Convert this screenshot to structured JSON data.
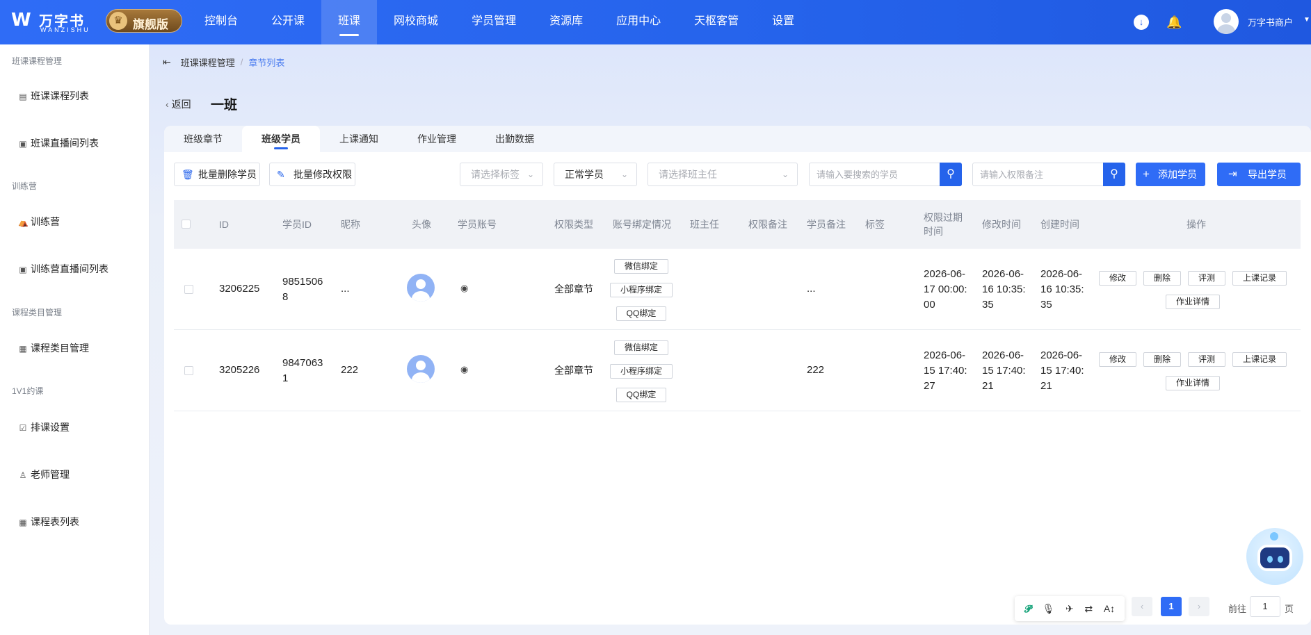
{
  "header": {
    "logo_mark": "W",
    "logo_cn": "万字书",
    "logo_en": "WANZISHU",
    "edition": "旗舰版",
    "nav": [
      "控制台",
      "公开课",
      "班课",
      "网校商城",
      "学员管理",
      "资源库",
      "应用中心",
      "天枢客管",
      "设置"
    ],
    "active_nav": "班课",
    "merchant": "万字书商户"
  },
  "sidebar": {
    "groups": [
      {
        "title": "班课课程管理",
        "items": [
          "班课课程列表",
          "班课直播间列表"
        ]
      },
      {
        "title": "训练营",
        "items": [
          "训练营",
          "训练营直播间列表"
        ]
      },
      {
        "title": "课程类目管理",
        "items": [
          "课程类目管理"
        ]
      },
      {
        "title": "1V1约课",
        "items": [
          "排课设置",
          "老师管理",
          "课程表列表"
        ]
      }
    ]
  },
  "breadcrumb": {
    "parent": "班课课程管理",
    "separator": "/",
    "current": "章节列表"
  },
  "page": {
    "back": "返回",
    "title": "一班"
  },
  "tabs": [
    "班级章节",
    "班级学员",
    "上课通知",
    "作业管理",
    "出勤数据"
  ],
  "active_tab": "班级学员",
  "toolbar": {
    "batch_delete": "批量删除学员",
    "batch_modify": "批量修改权限",
    "tag_select_placeholder": "请选择标签",
    "status_select_value": "正常学员",
    "teacher_select_placeholder": "请选择班主任",
    "student_search_placeholder": "请输入要搜索的学员",
    "remark_search_placeholder": "请输入权限备注",
    "add_student": "添加学员",
    "export_student": "导出学员"
  },
  "table": {
    "columns": [
      "ID",
      "学员ID",
      "昵称",
      "头像",
      "学员账号",
      "权限类型",
      "账号绑定情况",
      "班主任",
      "权限备注",
      "学员备注",
      "标签",
      "权限过期时间",
      "修改时间",
      "创建时间",
      "操作"
    ],
    "bind_labels": [
      "微信绑定",
      "小程序绑定",
      "QQ绑定"
    ],
    "actions": [
      "修改",
      "删除",
      "评测",
      "上课记录",
      "作业详情"
    ],
    "rows": [
      {
        "id": "3206225",
        "student_id": "98515068",
        "nickname": "...",
        "perm_type": "全部章节",
        "teacher": "",
        "perm_remark": "",
        "student_remark": "...",
        "tags": "",
        "expire": "2026-06-17 00:00:00",
        "modified": "2026-06-16 10:35:35",
        "created": "2026-06-16 10:35:35"
      },
      {
        "id": "3205226",
        "student_id": "98470631",
        "nickname": "222",
        "perm_type": "全部章节",
        "teacher": "",
        "perm_remark": "",
        "student_remark": "222",
        "tags": "",
        "expire": "2026-06-15 17:40:27",
        "modified": "2026-06-15 17:40:21",
        "created": "2026-06-15 17:40:21"
      }
    ]
  },
  "pagination": {
    "prev": "‹",
    "current": "1",
    "next": "›",
    "goto_prefix": "前往",
    "goto_value": "1",
    "goto_suffix": "页"
  },
  "colors": {
    "primary": "#2f6cf6",
    "header": "#2563eb",
    "edition_gold": "#a8793a"
  }
}
